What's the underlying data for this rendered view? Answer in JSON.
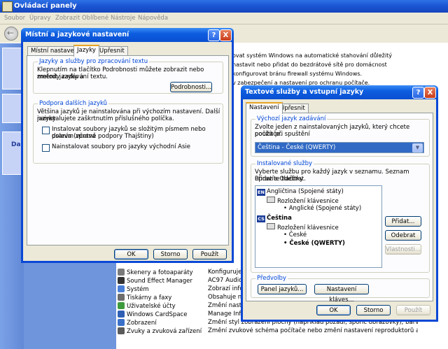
{
  "control_panel": {
    "title": "Ovládací panely",
    "menu": [
      "Soubor",
      "Úpravy",
      "Zobrazit",
      "Oblíbené",
      "Nástroje",
      "Nápověda"
    ],
    "left_pane_label": "Dal",
    "right_lines": [
      "ovat systém Windows na automatické stahování důležitý",
      "nastavit nebo přidat do bezdrátové sítě pro domácnost",
      "konfigurovat bránu firewall systému Windows.",
      "v zabezpečení a nastavení pro ochranu počítače."
    ],
    "items": [
      {
        "name": "Skenery a fotoaparáty",
        "desc": "Konfiguruje n",
        "color": "#7a7a7a"
      },
      {
        "name": "Sound Effect Manager",
        "desc": "AC97 Audio C",
        "color": "#333333"
      },
      {
        "name": "Systém",
        "desc": "Zobrazí inform",
        "color": "#4a7fd8"
      },
      {
        "name": "Tiskárny a faxy",
        "desc": "Obsahuje nain",
        "color": "#6d6d6d"
      },
      {
        "name": "Uživatelské účty",
        "desc": "Změní nastave",
        "color": "#3d9a3d"
      },
      {
        "name": "Windows CardSpace",
        "desc": "Manage Infor",
        "color": "#2f5fb3"
      },
      {
        "name": "Zobrazení",
        "desc": "Změní styl zobrazení plochy (například pozadí, spořič obrazovky), barvy, písma nebo rozlišení).",
        "color": "#3a70c8"
      },
      {
        "name": "Zvuky a zvuková zařízení",
        "desc": "Změní zvukové schéma počítače nebo změní nastavení reproduktorů a záznamových zaří",
        "color": "#5a5a5a"
      }
    ]
  },
  "regional_dialog": {
    "title": "Místní a jazykové nastavení",
    "tabs": [
      "Místní nastavení",
      "Jazyky",
      "Upřesnit"
    ],
    "active_tab": 1,
    "group1_title": "Jazyky a služby pro zpracování textu",
    "group1_text": [
      "Klepnutím na tlačítko Podrobnosti můžete zobrazit nebo změnit jazyky a",
      "metody zadávání textu."
    ],
    "details_button": "Podrobnosti...",
    "group2_title": "Podpora dalších jazyků",
    "group2_text": [
      "Většina jazyků je nainstalována při výchozím nastavení. Další jazyky",
      "nainstalujete zaškrtnutím příslušného políčka."
    ],
    "check1_label": [
      "Instalovat soubory jazyků se složitým písmem nebo psaním zprava",
      "doleva (včetně podpory Thajštiny)"
    ],
    "check1_checked": false,
    "check2_label": "Nainstalovat soubory pro jazyky východní Asie",
    "check2_checked": false,
    "buttons": {
      "ok": "OK",
      "cancel": "Storno",
      "apply": "Použít"
    },
    "help_glyph": "?",
    "close_glyph": "X"
  },
  "text_services_dialog": {
    "title": "Textové služby a vstupní jazyky",
    "tabs": [
      "Nastavení",
      "Upřesnit"
    ],
    "active_tab": 0,
    "default_group_title": "Výchozí jazyk zadávání",
    "default_group_text": [
      "Zvolte jeden z nainstalovaných jazyků, který chcete použít při spuštění",
      "počítače."
    ],
    "default_language": "Čeština - České (QWERTY)",
    "installed_group_title": "Instalované služby",
    "installed_group_text": [
      "Vyberte službu pro každý jazyk v seznamu. Seznam upravíte tlačítky",
      "Přidat a Odebrat."
    ],
    "tree": {
      "lang1_code": "EN",
      "lang1": "Angličtina (Spojené státy)",
      "lang1_cat": "Rozložení klávesnice",
      "lang1_item": "Anglické (Spojené státy)",
      "lang2_code": "CS",
      "lang2": "Čeština",
      "lang2_cat": "Rozložení klávesnice",
      "lang2_item1": "České",
      "lang2_item2": "České (QWERTY)"
    },
    "add_button": "Přidat...",
    "remove_button": "Odebrat",
    "properties_button": "Vlastnosti...",
    "prefs_group_title": "Předvolby",
    "language_bar_button": "Panel jazyků...",
    "key_settings_button": "Nastavení kláves...",
    "buttons": {
      "ok": "OK",
      "cancel": "Storno",
      "apply": "Použít"
    },
    "help_glyph": "?",
    "close_glyph": "X"
  }
}
